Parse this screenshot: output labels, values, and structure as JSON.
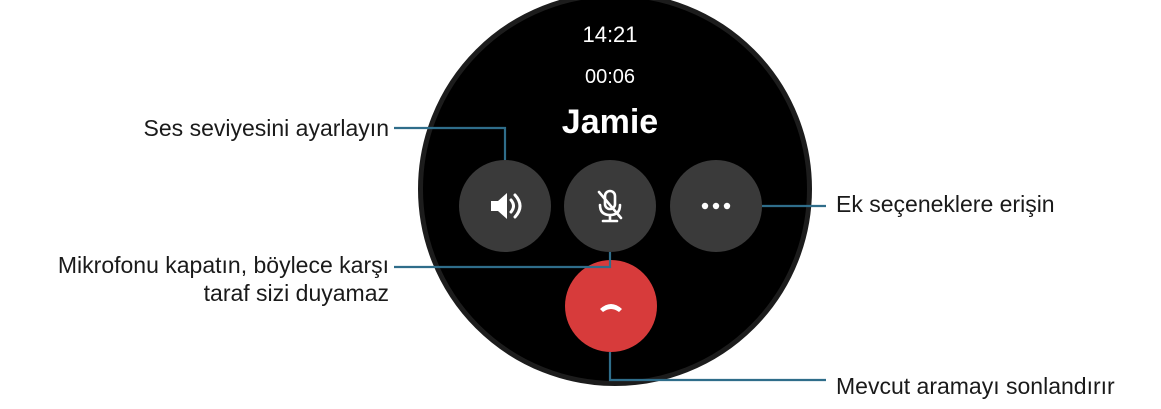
{
  "watch": {
    "time": "14:21",
    "call_duration": "00:06",
    "caller_name": "Jamie",
    "buttons": {
      "volume": {
        "icon": "speaker-icon"
      },
      "mute": {
        "icon": "mic-off-icon"
      },
      "more": {
        "icon": "more-dots-icon"
      },
      "end_call": {
        "icon": "end-call-icon",
        "color": "#d73b3b"
      }
    }
  },
  "annotations": {
    "volume": "Ses seviyesini ayarlayın",
    "mic_line1": "Mikrofonu kapatın, böylece karşı",
    "mic_line2": "taraf sizi duyamaz",
    "more": "Ek seçeneklere erişin",
    "end_call": "Mevcut aramayı sonlandırır"
  },
  "colors": {
    "leader_line": "#2f6d8a",
    "button_bg": "#3a3a3a",
    "end_call": "#d73b3b"
  }
}
